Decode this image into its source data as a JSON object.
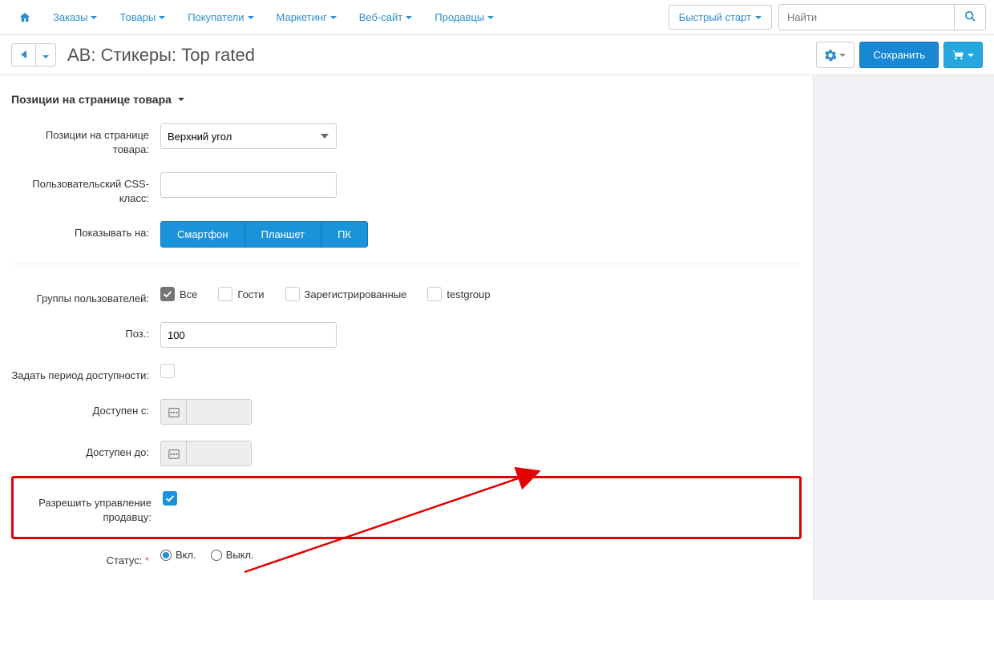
{
  "nav": {
    "orders": "Заказы",
    "products": "Товары",
    "customers": "Покупатели",
    "marketing": "Маркетинг",
    "website": "Веб-сайт",
    "vendors": "Продавцы"
  },
  "topbar": {
    "quick_start": "Быстрый старт",
    "search_placeholder": "Найти"
  },
  "titlebar": {
    "title": "AB: Стикеры: Top rated",
    "save": "Сохранить"
  },
  "section_header": "Позиции на странице товара",
  "labels": {
    "product_page_positions": "Позиции на странице товара:",
    "css_class": "Пользовательский CSS-класс:",
    "display_on": "Показывать на:",
    "user_groups": "Группы пользователей:",
    "position": "Поз.:",
    "set_availability_period": "Задать период доступности:",
    "available_from": "Доступен с:",
    "available_to": "Доступен до:",
    "allow_vendor_manage": "Разрешить управление продавцу:",
    "status": "Статус:"
  },
  "fields": {
    "product_page_positions_value": "Верхний угол",
    "css_class_value": "",
    "display": {
      "smartphone": "Смартфон",
      "tablet": "Планшет",
      "pc": "ПК"
    },
    "user_groups": {
      "all": "Все",
      "guests": "Гости",
      "registered": "Зарегистрированные",
      "testgroup": "testgroup"
    },
    "position_value": "100",
    "status_on": "Вкл.",
    "status_off": "Выкл."
  }
}
